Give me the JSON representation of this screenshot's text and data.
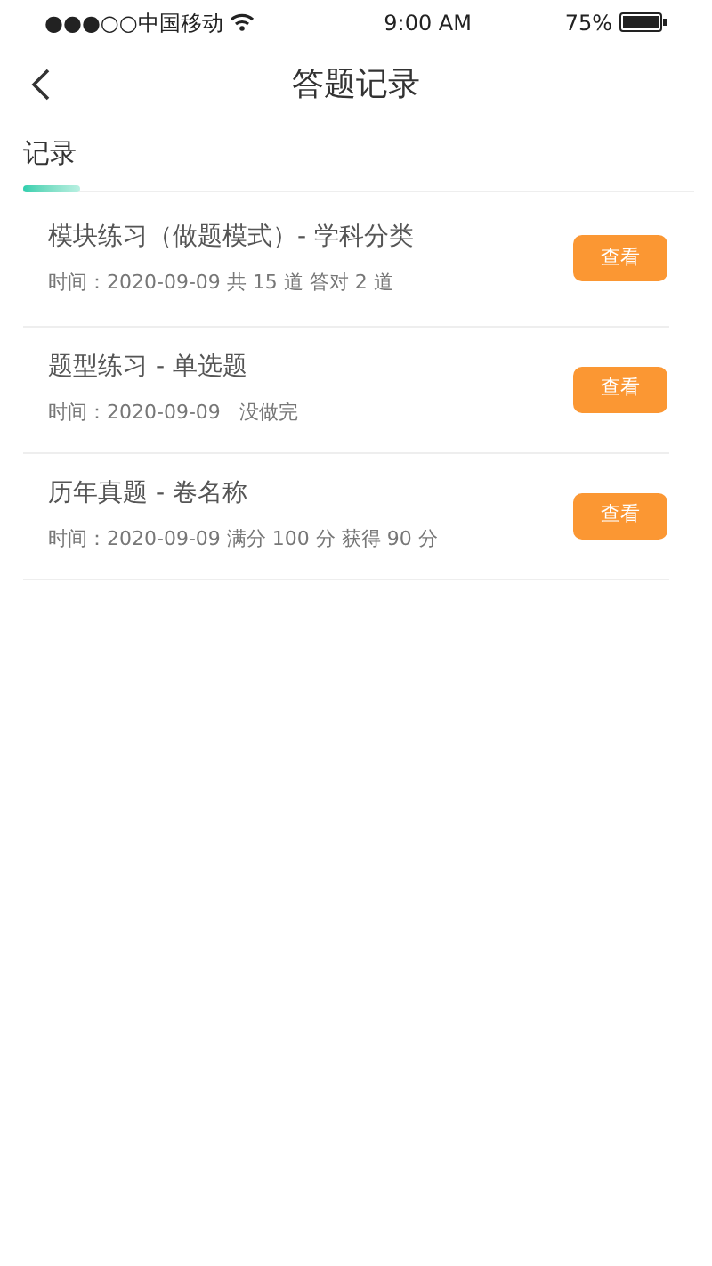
{
  "status_bar": {
    "carrier": "●●●○○中国移动",
    "time": "9:00 AM",
    "battery": "75%"
  },
  "nav": {
    "title": "答题记录"
  },
  "tabs": [
    {
      "label": "记录",
      "selected": true
    }
  ],
  "records": [
    {
      "title": "模块练习（做题模式）- 学科分类",
      "meta": "时间：2020-09-09 共 15 道 答对 2 道",
      "button": "查看"
    },
    {
      "title": "题型练习 - 单选题",
      "meta": "时间：2020-09-09   没做完",
      "button": "查看"
    },
    {
      "title": "历年真题 - 卷名称",
      "meta": "时间：2020-09-09 满分 100 分 获得 90 分",
      "button": "查看"
    }
  ]
}
